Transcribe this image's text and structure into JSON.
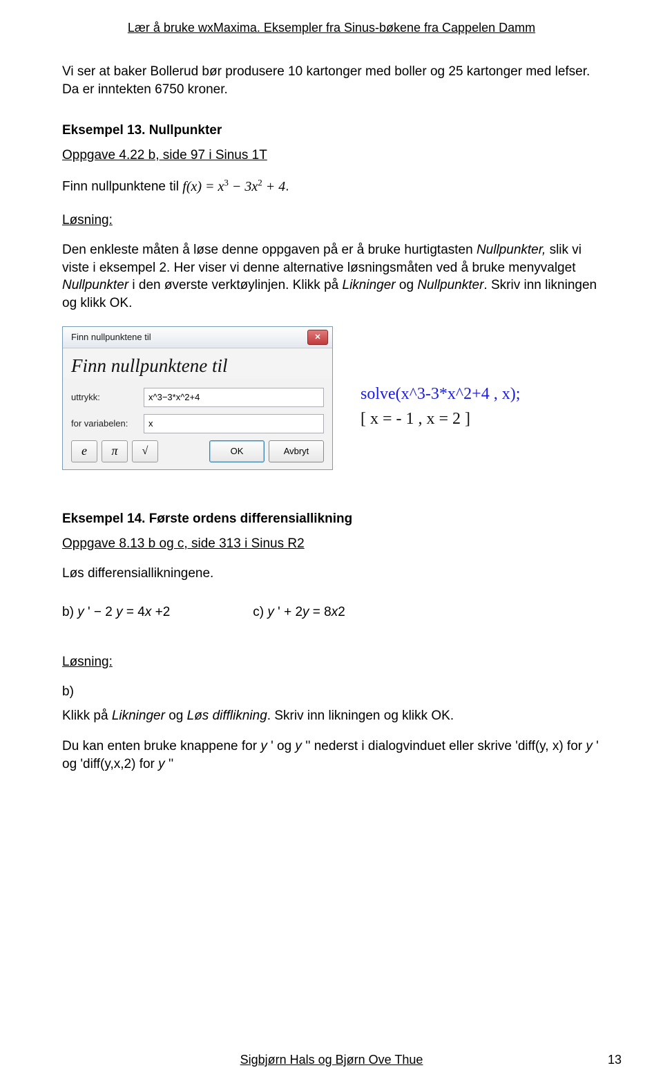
{
  "header": "Lær å bruke wxMaxima. Eksempler fra Sinus-bøkene fra Cappelen Damm",
  "intro": "Vi ser at baker Bollerud bør produsere 10 kartonger med boller og 25 kartonger med lefser. Da er inntekten 6750 kroner.",
  "ex13": {
    "heading": "Eksempel 13. Nullpunkter",
    "task_ref": "Oppgave 4.22 b, side 97 i Sinus 1T",
    "find_prefix": "Finn nullpunktene til ",
    "formula_html": "f(x) = x<span class='sup'>3</span> − 3x<span class='sup'>2</span> + 4",
    "solution_label": "Løsning:",
    "body": "Den enkleste måten å løse denne oppgaven på er å bruke hurtigtasten <span class='ital'>Nullpunkter,</span> slik vi viste i eksempel 2. Her viser vi denne alternative løsningsmåten ved å bruke menyvalget <span class='ital'>Nullpunkter</span> i den øverste verktøylinjen. Klikk på <span class='ital'>Likninger</span> og <span class='ital'>Nullpunkter</span>. Skriv inn likningen og klikk OK."
  },
  "dialog": {
    "title": "Finn nullpunktene til",
    "heading": "Finn nullpunktene til",
    "label_expr": "uttrykk:",
    "value_expr": "x^3−3*x^2+4",
    "label_var": "for variabelen:",
    "value_var": "x",
    "sym_e": "e",
    "sym_pi": "π",
    "sym_sqrt": "√",
    "ok": "OK",
    "cancel": "Avbryt",
    "close": "✕"
  },
  "code": {
    "line1": "solve(x^3-3*x^2+4   , x);",
    "line2": "[ x = - 1 , x = 2 ]"
  },
  "ex14": {
    "heading": "Eksempel 14. Første ordens differensiallikning",
    "task_ref": "Oppgave 8.13 b og c, side 313 i Sinus R2",
    "instr": "Løs differensiallikningene.",
    "eq_b": "b) <span class='ital'>y</span> ' − 2 <span class='ital'>y</span> = 4<span class='ital'>x</span> +2",
    "eq_c": "c) <span class='ital'>y</span> ' + 2<span class='ital'>y</span> = 8<span class='ital'>x</span><span class='sup'>2</span>",
    "solution_label": "Løsning:",
    "sol_b_label": "b)",
    "sol_b_text": "Klikk på <span class='ital'>Likninger</span> og <span class='ital'>Løs difflikning</span>. Skriv inn likningen og klikk OK.",
    "sol_note": "Du kan enten bruke knappene for <span class='ital'>y</span> ' og <span class='ital'>y</span> '' nederst i dialogvinduet eller skrive 'diff(y, x) for <span class='ital'>y</span> ' og 'diff(y,x,2) for <span class='ital'>y</span> ''"
  },
  "footer": "Sigbjørn Hals og Bjørn Ove Thue",
  "page_num": "13"
}
